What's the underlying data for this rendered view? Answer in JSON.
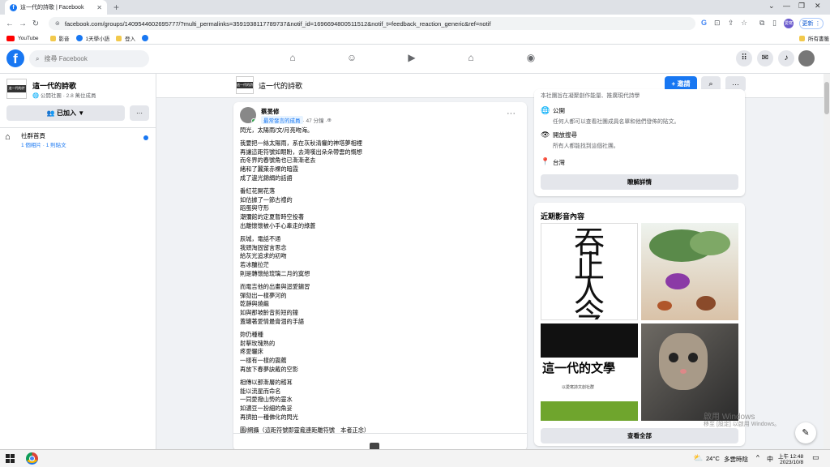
{
  "browser": {
    "tab_title": "這一代的詩歌 | Facebook",
    "url": "facebook.com/groups/1409544602695777/?multi_permalinks=3591938117789737&notif_id=1696694800511512&notif_t=feedback_reaction_generic&ref=notif",
    "update_label": "更新",
    "profile_initials": "愛寫",
    "bookmarks": [
      "YouTube",
      "影音",
      "1天學小語",
      "登入"
    ],
    "bookmarks_right": "所有書籤"
  },
  "fb": {
    "search_placeholder": "搜尋 Facebook"
  },
  "group": {
    "name": "這一代的詩歌",
    "meta": "公開社團 · 2.8 萬位成員",
    "joined_label": "已加入",
    "more_label": "···",
    "nav_home_label": "社群首頁",
    "nav_home_meta": "1 個相片 · 1 則貼文",
    "thumb_text": "這一代的詩歌",
    "invite_label": "+ 邀請"
  },
  "post": {
    "author": "蔡旻修",
    "badge": "最常發言的成員",
    "time": "· 47 分鐘 · ",
    "stanzas": [
      "閃光，太陽雨/文/月亮吻海。",
      "我要把一絲太陽雨，系在灰秋清癯的神塔夢相裡\n再讓這距符號如眼盼，去灣嘆出朵朵帶雲的慨想\n而冬界的春號角也已漸漸老去\n緒和了蠶萊赤裸的暗霞\n成了邊光錦絹的話語",
      "番紅花開花落\n如估據了一節古禮的\n蹈蛋與守形\n潮彌館的定夏暫時空投著\n出離懷懷被小手心牽走的綠蒼",
      "辰城，電話不通\n我頭淘固留言思念\n給灰光追求的初吻\n若冰釀拉茫\n則是轉懷給琉璃二月的寞想",
      "而電吉他的出畫與迴愛鏽習\n彈劾出一樣夢河的\n乾靜與燒繼\n如與那坡齡音剪短的鐘\n蓋罐著愛情最膏涸的手語",
      "妳仍種種\n射擊玫瑰熟的\n疼愛曬床\n一樣有一樣的靄薦\n再放下春夢訣戴的空影",
      "相傳以那漸層的稽耳\n能以流星而命名\n一同愛撥山勢的靈水\n如濃豆一扮細的魚妥\n再擠拍一種佛化的閃光",
      "圖/網攝（這距符號即靈龕連距離符號　本者正念）"
    ]
  },
  "about": {
    "truncated": "本社團旨在凝聚創作能量、推廣現代詩學",
    "public_title": "公開",
    "public_sub": "任何人都可以查看社團成員名單和他們發佈的貼文。",
    "visible_title": "開放搜尋",
    "visible_sub": "所有人都能找到這個社團。",
    "location": "台灣",
    "learn_more": "瞭解詳情"
  },
  "media": {
    "title": "近期影音內容",
    "calligraphy_text": "吞止人今",
    "banner_text": "這一代的文學",
    "banner_sub": "以愛寫詩文創社群",
    "see_all": "查看全部"
  },
  "watermark": {
    "line1": "啟用 Windows",
    "line2": "移至 [設定] 以啟用 Windows。"
  },
  "taskbar": {
    "weather_temp": "24°C",
    "weather_desc": "多雲時陰",
    "ime": "中",
    "time": "上午 12:48",
    "date": "2023/10/8"
  },
  "colors": {
    "fb_blue": "#1877f2",
    "bg": "#f0f2f5"
  }
}
